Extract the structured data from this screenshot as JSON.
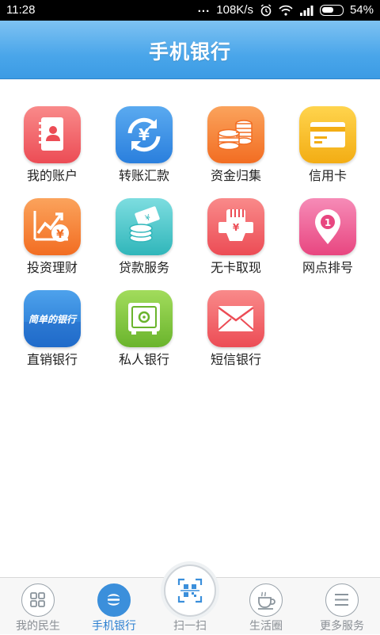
{
  "status_bar": {
    "time": "11:28",
    "dots": "...",
    "speed": "108K/s",
    "battery": "54%"
  },
  "header": {
    "title": "手机银行"
  },
  "grid": {
    "items": [
      {
        "label": "我的账户",
        "icon": "account-book-icon",
        "color": "#f0575e"
      },
      {
        "label": "转账汇款",
        "icon": "transfer-yen-icon",
        "color": "#2f8ce6"
      },
      {
        "label": "资金归集",
        "icon": "coin-stack-icon",
        "color": "#f57b2c"
      },
      {
        "label": "信用卡",
        "icon": "credit-card-icon",
        "color": "#f5b820"
      },
      {
        "label": "投资理财",
        "icon": "investment-chart-icon",
        "color": "#f57b2c"
      },
      {
        "label": "贷款服务",
        "icon": "loan-cash-icon",
        "color": "#3cc2c4"
      },
      {
        "label": "无卡取现",
        "icon": "cardless-cash-icon",
        "color": "#f0575e"
      },
      {
        "label": "网点排号",
        "icon": "location-queue-icon",
        "color": "#ee4e8a"
      },
      {
        "label": "直销银行",
        "icon": "direct-bank-icon",
        "color": "#2f8ce6",
        "logo_text": "简单的银行"
      },
      {
        "label": "私人银行",
        "icon": "safe-icon",
        "color": "#7cc23c"
      },
      {
        "label": "短信银行",
        "icon": "envelope-icon",
        "color": "#f0575e"
      }
    ]
  },
  "tabbar": {
    "tabs": [
      {
        "label": "我的民生",
        "icon": "grid-icon",
        "active": false
      },
      {
        "label": "手机银行",
        "icon": "cmbc-logo-icon",
        "active": true
      },
      {
        "label": "扫一扫",
        "icon": "scan-qr-icon",
        "active": false
      },
      {
        "label": "生活圈",
        "icon": "coffee-cup-icon",
        "active": false
      },
      {
        "label": "更多服务",
        "icon": "menu-icon",
        "active": false
      }
    ]
  }
}
